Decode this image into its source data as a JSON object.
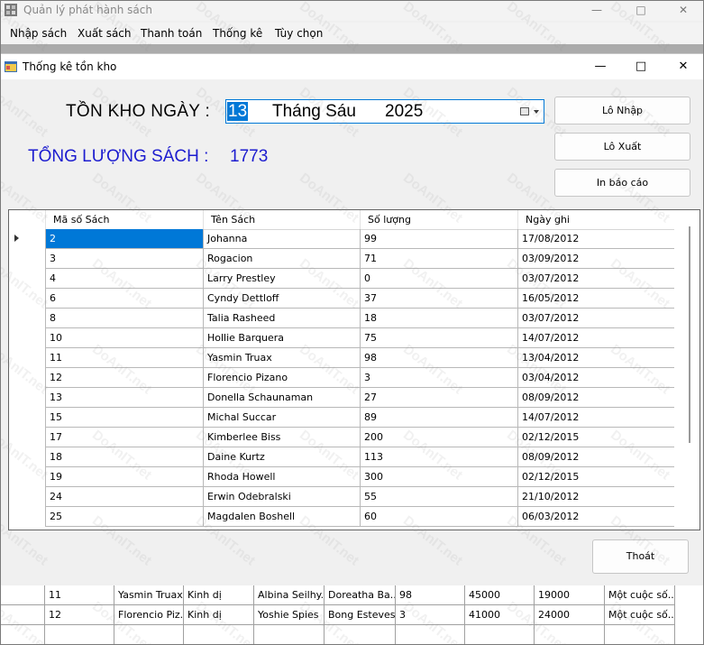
{
  "main_window": {
    "title": "Quản lý phát hành sách",
    "menu": [
      "Nhập sách",
      "Xuất sách",
      "Thanh toán",
      "Thống kê",
      "Tùy chọn"
    ]
  },
  "child_window": {
    "title": "Thống kê tồn kho",
    "date_label": "TỒN KHO NGÀY :",
    "date_day": "13",
    "date_month": "Tháng Sáu",
    "date_year": "2025",
    "total_label": "TỔNG LƯỢNG SÁCH :",
    "total_value": "1773",
    "buttons": {
      "lo_nhap": "Lô Nhập",
      "lo_xuat": "Lô Xuất",
      "in_bao_cao": "In báo cáo",
      "thoat": "Thoát"
    },
    "grid": {
      "columns": [
        "Mã số Sách",
        "Tên Sách",
        "Số lượng",
        "Ngày ghi"
      ],
      "rows": [
        [
          "2",
          "Johanna",
          "99",
          "17/08/2012"
        ],
        [
          "3",
          "Rogacion",
          "71",
          "03/09/2012"
        ],
        [
          "4",
          "Larry Prestley",
          "0",
          "03/07/2012"
        ],
        [
          "6",
          "Cyndy Dettloff",
          "37",
          "16/05/2012"
        ],
        [
          "8",
          "Talia Rasheed",
          "18",
          "03/07/2012"
        ],
        [
          "10",
          "Hollie Barquera",
          "75",
          "14/07/2012"
        ],
        [
          "11",
          "Yasmin Truax",
          "98",
          "13/04/2012"
        ],
        [
          "12",
          "Florencio Pizano",
          "3",
          "03/04/2012"
        ],
        [
          "13",
          "Donella Schaunaman",
          "27",
          "08/09/2012"
        ],
        [
          "15",
          "Michal Succar",
          "89",
          "14/07/2012"
        ],
        [
          "17",
          "Kimberlee Biss",
          "200",
          "02/12/2015"
        ],
        [
          "18",
          "Daine Kurtz",
          "113",
          "08/09/2012"
        ],
        [
          "19",
          "Rhoda Howell",
          "300",
          "02/12/2015"
        ],
        [
          "24",
          "Erwin Odebralski",
          "55",
          "21/10/2012"
        ],
        [
          "25",
          "Magdalen Boshell",
          "60",
          "06/03/2012"
        ]
      ]
    }
  },
  "background_grid": {
    "rows": [
      [
        "11",
        "Yasmin Truax",
        "Kinh dị",
        "Albina Seilhy...",
        "Doreatha Ba...",
        "98",
        "45000",
        "19000",
        "Một cuộc số..."
      ],
      [
        "12",
        "Florencio Piz...",
        "Kinh dị",
        "Yoshie Spies",
        "Bong Esteves",
        "3",
        "41000",
        "24000",
        "Một cuộc số..."
      ]
    ]
  },
  "watermark": "DoAnIT.net"
}
